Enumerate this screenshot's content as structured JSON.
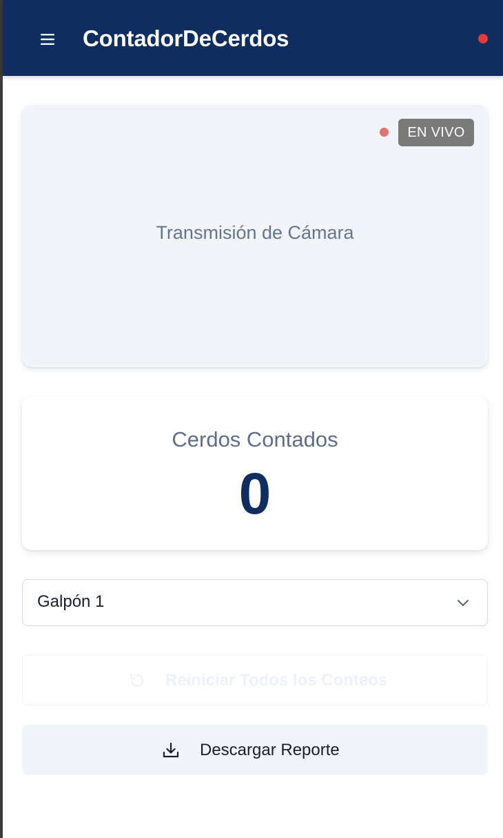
{
  "header": {
    "title": "ContadorDeCerdos",
    "menu_icon": "hamburger-menu-icon",
    "status_color": "#e53935",
    "background_color": "#0f2d5e"
  },
  "camera": {
    "live_badge": "EN VIVO",
    "live_indicator_color": "#e57373",
    "placeholder_text": "Transmisión de Cámara"
  },
  "counter": {
    "label": "Cerdos Contados",
    "value": "0"
  },
  "barn_select": {
    "selected": "Galpón 1",
    "icon": "chevron-down-icon"
  },
  "actions": {
    "reset_label": "Reiniciar Todos los Conteos",
    "reset_icon": "reset-icon",
    "reset_disabled": true,
    "download_label": "Descargar Reporte",
    "download_icon": "download-icon"
  }
}
